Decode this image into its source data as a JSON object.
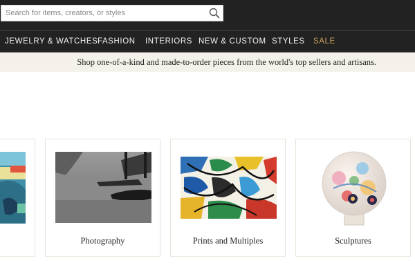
{
  "search": {
    "placeholder": "Search for items, creators, or styles",
    "value": ""
  },
  "nav": {
    "items": [
      {
        "label": "JEWELRY & WATCHES"
      },
      {
        "label": "FASHION"
      },
      {
        "label": "INTERIORS"
      },
      {
        "label": "NEW & CUSTOM"
      },
      {
        "label": "STYLES"
      },
      {
        "label": "SALE"
      }
    ],
    "sale_color": "#c9a45c"
  },
  "promo": {
    "text": "Shop one-of-a-kind and made-to-order pieces from the world's top sellers and artisans."
  },
  "categories": [
    {
      "label": ""
    },
    {
      "label": "Photography"
    },
    {
      "label": "Prints and Multiples"
    },
    {
      "label": "Sculptures"
    }
  ],
  "colors": {
    "header_bg": "#222222",
    "promo_bg": "#f4f1ea",
    "card_border": "#e6e3d8"
  }
}
